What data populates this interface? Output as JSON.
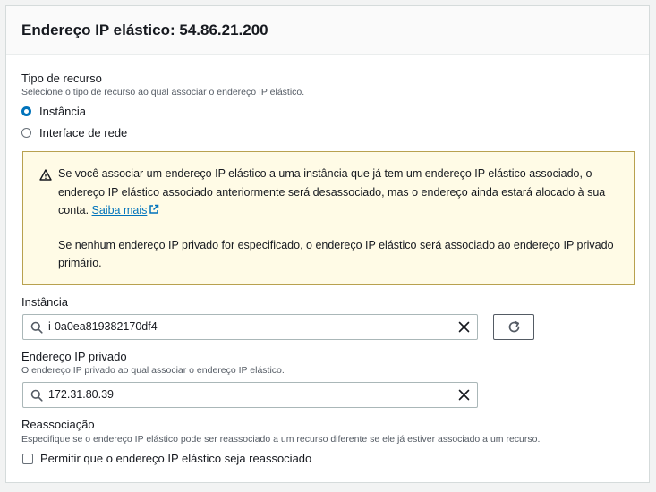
{
  "header": {
    "title": "Endereço IP elástico: 54.86.21.200"
  },
  "resource_type": {
    "label": "Tipo de recurso",
    "description": "Selecione o tipo de recurso ao qual associar o endereço IP elástico.",
    "options": [
      {
        "label": "Instância",
        "checked": true
      },
      {
        "label": "Interface de rede",
        "checked": false
      }
    ]
  },
  "alert": {
    "paragraph1_line1": "Se você associar um endereço IP elástico a uma instância que já tem um endereço IP elástico associado, o",
    "paragraph1_line2": "endereço IP elástico associado anteriormente será desassociado, mas o endereço ainda estará alocado à sua",
    "paragraph1_line3_prefix": "conta. ",
    "link_text": "Saiba mais",
    "paragraph2_line1": "Se nenhum endereço IP privado for especificado, o endereço IP elástico será associado ao endereço IP privado",
    "paragraph2_line2": "primário.",
    "icon": "warning-icon"
  },
  "instance": {
    "label": "Instância",
    "value": "i-0a0ea819382170df4"
  },
  "private_ip": {
    "label": "Endereço IP privado",
    "description": "O endereço IP privado ao qual associar o endereço IP elástico.",
    "value": "172.31.80.39"
  },
  "reassociation": {
    "label": "Reassociação",
    "description": "Especifique se o endereço IP elástico pode ser reassociado a um recurso diferente se ele já estiver associado a um recurso.",
    "checkbox_label": "Permitir que o endereço IP elástico seja reassociado",
    "checked": false
  },
  "colors": {
    "accent": "#0073bb",
    "alert_bg": "#fffbe6",
    "alert_border": "#b8a14f"
  }
}
